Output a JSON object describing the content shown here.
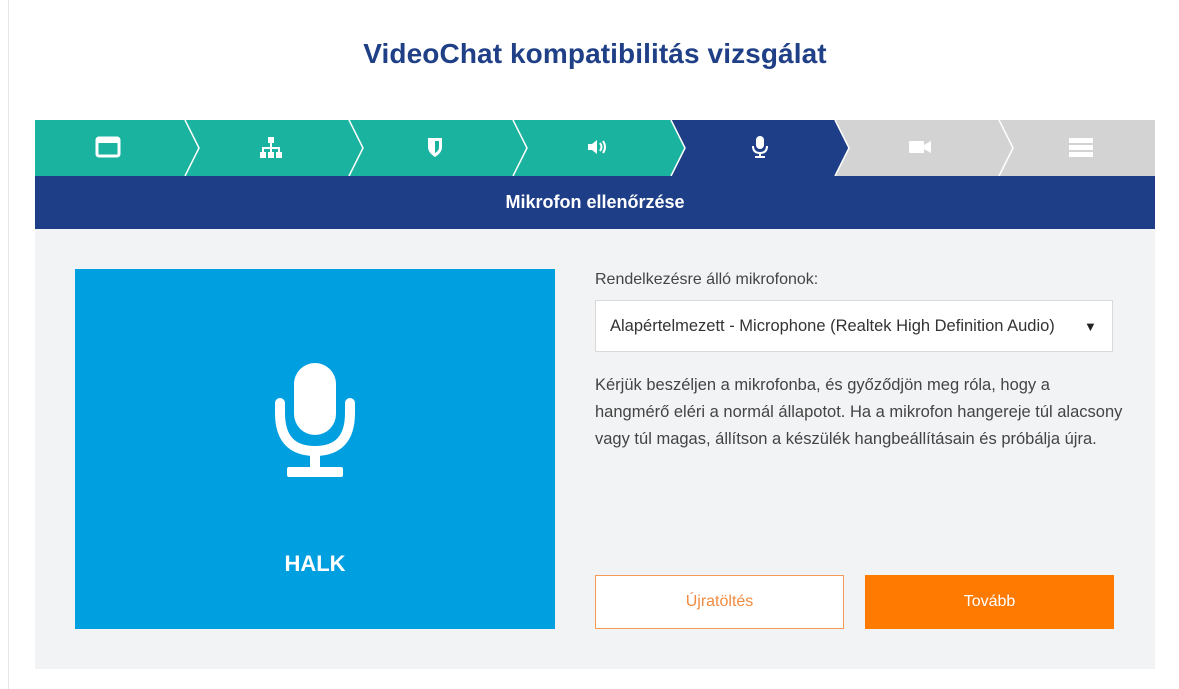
{
  "page": {
    "title": "VideoChat kompatibilitás vizsgálat"
  },
  "stepper": {
    "steps": [
      {
        "icon": "browser-window-icon",
        "state": "done"
      },
      {
        "icon": "network-icon",
        "state": "done"
      },
      {
        "icon": "shield-icon",
        "state": "done"
      },
      {
        "icon": "speaker-icon",
        "state": "done"
      },
      {
        "icon": "microphone-icon",
        "state": "active"
      },
      {
        "icon": "camera-icon",
        "state": "pending"
      },
      {
        "icon": "server-icon",
        "state": "pending"
      }
    ],
    "colors": {
      "done": "#1ab3a0",
      "active": "#1e3f88",
      "pending": "#d3d3d3"
    }
  },
  "section": {
    "title": "Mikrofon ellenőrzése"
  },
  "mic_preview": {
    "icon": "microphone-icon",
    "status": "HALK",
    "color": "#009fe0"
  },
  "form": {
    "mic_label": "Rendelkezésre álló mikrofonok:",
    "mic_selected": "Alapértelmezett - Microphone (Realtek High Definition Audio)",
    "instructions": "Kérjük beszéljen a mikrofonba, és győződjön meg róla, hogy a hangmérő eléri a normál állapotot. Ha a mikrofon hangereje túl alacsony vagy túl magas, állítson a készülék hangbeállításain és próbálja újra."
  },
  "buttons": {
    "reload_label": "Újratöltés",
    "next_label": "Tovább"
  }
}
